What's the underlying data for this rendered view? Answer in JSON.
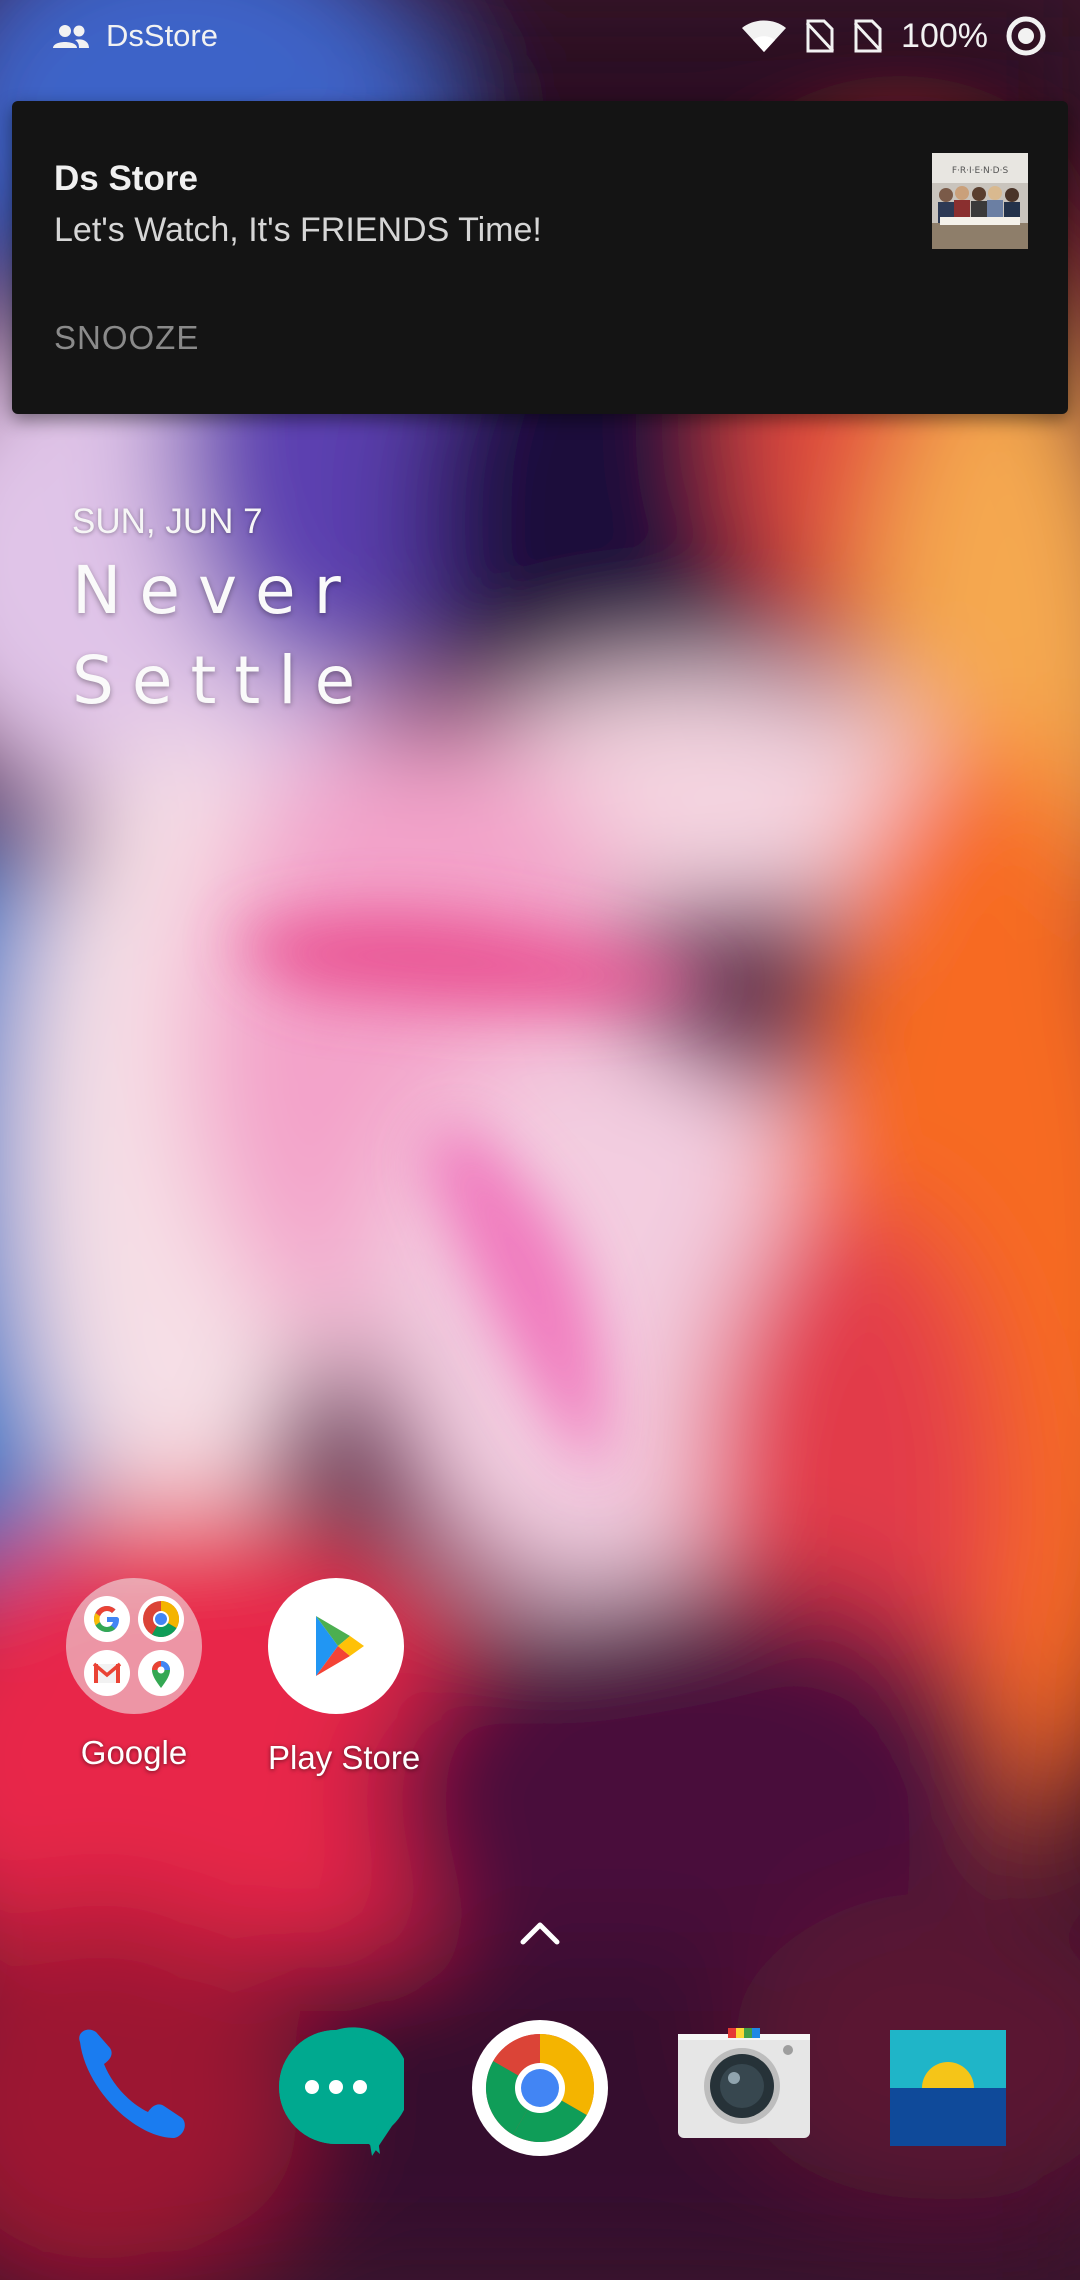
{
  "status_bar": {
    "app_name": "DsStore",
    "battery_text": "100%",
    "icons": [
      "people-icon",
      "wifi-icon",
      "no-sim-icon",
      "no-sim-icon",
      "circle-target-icon"
    ]
  },
  "notification": {
    "title": "Ds Store",
    "message": "Let's Watch, It's FRIENDS Time!",
    "action_label": "SNOOZE",
    "thumbnail_icon": "friends-thumbnail-image"
  },
  "widget": {
    "date": "SUN, JUN 7",
    "tagline_line1": "Never",
    "tagline_line2": "Settle"
  },
  "home_apps": [
    {
      "label": "Google",
      "icon": "google-folder-icon"
    },
    {
      "label": "Play Store",
      "icon": "play-store-icon"
    }
  ],
  "app_drawer_icon": "chevron-up-icon",
  "dock": [
    {
      "name": "Phone",
      "icon": "phone-icon"
    },
    {
      "name": "Messages",
      "icon": "messages-icon"
    },
    {
      "name": "Chrome",
      "icon": "chrome-icon"
    },
    {
      "name": "Camera",
      "icon": "camera-icon"
    },
    {
      "name": "Gallery",
      "icon": "gallery-icon"
    }
  ],
  "colors": {
    "notification_bg": "#141414",
    "chrome_red": "#DB4437",
    "chrome_yellow": "#F4B400",
    "chrome_green": "#0F9D58",
    "chrome_blue": "#4285F4",
    "messages_teal": "#00A98F",
    "phone_blue": "#1a7cf0"
  }
}
